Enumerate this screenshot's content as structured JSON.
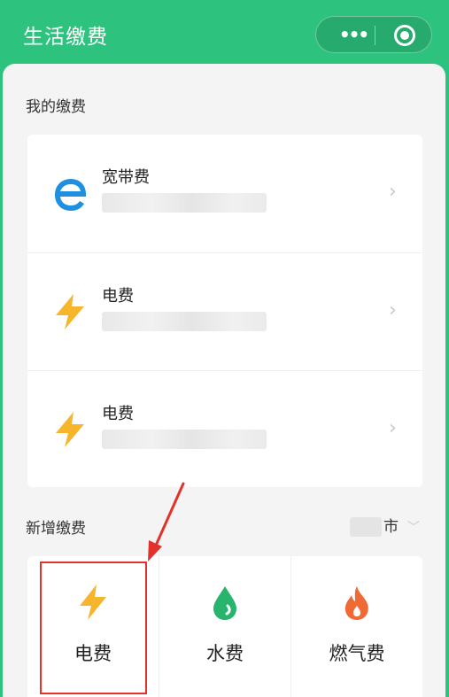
{
  "header": {
    "title": "生活缴费",
    "more_icon": "more-dots-icon",
    "close_icon": "mini-program-close-icon",
    "color": "#2dc27d"
  },
  "my_payments": {
    "title": "我的缴费",
    "items": [
      {
        "label": "宽带费",
        "icon": "broadband-e-icon"
      },
      {
        "label": "电费",
        "icon": "lightning-icon"
      },
      {
        "label": "电费",
        "icon": "lightning-icon"
      }
    ]
  },
  "new_payments": {
    "title": "新增缴费",
    "city_suffix": "市",
    "tiles": [
      {
        "label": "电费",
        "icon": "lightning-icon"
      },
      {
        "label": "水费",
        "icon": "water-drop-icon"
      },
      {
        "label": "燃气费",
        "icon": "flame-icon"
      }
    ]
  },
  "colors": {
    "lightning": "#f7b52c",
    "broadband": "#1f8fe0",
    "water": "#27b46c",
    "gas": "#f06a35",
    "annotation": "#e4312b"
  }
}
